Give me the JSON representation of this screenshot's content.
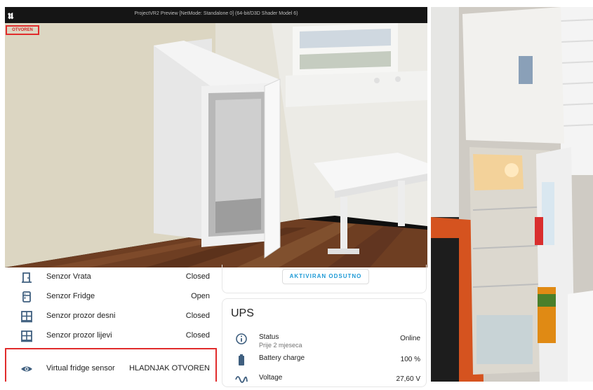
{
  "unreal": {
    "logo": "𝖚",
    "window_title": "ProjectVR2 Preview [NetMode: Standalone 0]  (64-bit/D3D Shader Model 6)",
    "overlay_status": "OTVOREN"
  },
  "colors": {
    "accent": "#1e9ad6",
    "icon": "#3f5f7f",
    "highlight_border": "#e12c2c"
  },
  "sensors": [
    {
      "icon": "door-icon",
      "name": "Senzor Vrata",
      "state": "Closed"
    },
    {
      "icon": "fridge-icon",
      "name": "Senzor Fridge",
      "state": "Open"
    },
    {
      "icon": "window-icon",
      "name": "Senzor prozor desni",
      "state": "Closed"
    },
    {
      "icon": "window-icon",
      "name": "Senzor prozor lijevi",
      "state": "Closed"
    }
  ],
  "virtual_sensor": {
    "icon": "eye-icon",
    "name": "Virtual fridge sensor",
    "state": "HLADNJAK OTVOREN"
  },
  "mode_button": "AKTIVIRAN ODSUTNO",
  "ups": {
    "title": "UPS",
    "rows": [
      {
        "icon": "info-icon",
        "name": "Status",
        "secondary": "Prije 2 mjeseca",
        "state": "Online"
      },
      {
        "icon": "battery-icon",
        "name": "Battery charge",
        "secondary": "",
        "state": "100 %"
      },
      {
        "icon": "sine-wave-icon",
        "name": "Voltage",
        "secondary": "",
        "state": "27,60 V"
      }
    ]
  }
}
